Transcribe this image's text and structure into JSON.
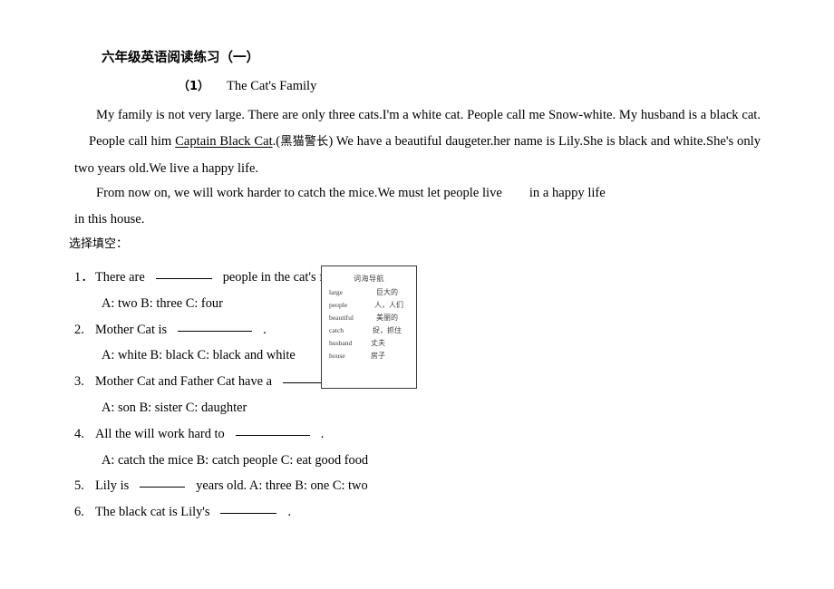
{
  "document": {
    "title": "六年级英语阅读练习（一）",
    "subtitle_number": "（1）",
    "subtitle_text": "The Cat's Family",
    "paragraphs": {
      "p1_part1": "My family is not very large. There are only three cats.I'm a white cat. People call me Snow-white. My husband is a black cat.",
      "p1_part2": "People call him ",
      "p1_underlined": "Captain Black Cat",
      "p1_part3": ".(",
      "p1_chinese": "黑猫警长",
      "p1_part4": ") We have a beautiful daugeter.her name is Lily.She is black and white.She's only two years old.We live a happy life.",
      "p2": "From now on, we will work harder to catch the mice.We must let people live",
      "p2_tail": "in a happy life in this house."
    },
    "section_label": "选择填空：",
    "questions": [
      {
        "number": "1．",
        "text_before": "There are",
        "blank": "b-md",
        "text_after": "people in the cat's family.",
        "options": "A: two          B: three     C: four"
      },
      {
        "number": "2.",
        "text_before": "Mother Cat is",
        "blank": "b-lg",
        "text_after": ".",
        "options": "A: white       B: black     C: black and white"
      },
      {
        "number": "3.",
        "text_before": "Mother Cat and Father Cat have a",
        "blank": "b-lg",
        "text_after": "",
        "options": "A: son            B: sister     C: daughter"
      },
      {
        "number": "4.",
        "text_before": "All the will work hard to",
        "blank": "b-lg",
        "text_after": ".",
        "options": "A: catch the mice     B: catch people     C: eat good food"
      },
      {
        "number": "5.",
        "text_before": "Lily is",
        "blank": "b-sm",
        "text_after": "years old.        A: three     B: one     C: two",
        "options": ""
      },
      {
        "number": "6.",
        "text_before": "The black cat is Lily's",
        "blank": "b-md",
        "text_after": ".",
        "options": ""
      }
    ],
    "vocab_box": {
      "title": "词海导航",
      "entries": [
        {
          "en": "large",
          "cn": "巨大的"
        },
        {
          "en": "people",
          "cn": "人，人们"
        },
        {
          "en": "beautiful",
          "cn": "美丽的"
        },
        {
          "en": "catch",
          "cn": "捉，抓住"
        },
        {
          "en": "husband",
          "cn": "丈夫"
        },
        {
          "en": "house",
          "cn": "房子"
        }
      ]
    }
  },
  "colors": {
    "text": "#000000",
    "box_border": "#3a3a3a",
    "box_text": "#3b3b3b",
    "background": "#ffffff"
  }
}
